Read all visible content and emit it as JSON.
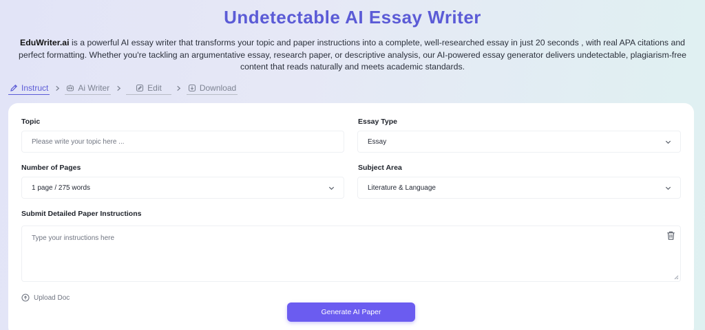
{
  "hero": {
    "title": "Undetectable AI Essay Writer",
    "brand": "EduWriter.ai",
    "description": " is a powerful AI essay writer that transforms your topic and paper instructions into a complete, well-researched essay in just 20 seconds , with real APA citations and perfect formatting. Whether you're tackling an argumentative essay, research paper, or descriptive analysis, our AI-powered essay generator delivers undetectable, plagiarism-free content that reads naturally and meets academic standards."
  },
  "steps": [
    {
      "label": "Instruct",
      "icon": "pencil-icon",
      "active": true
    },
    {
      "label": "Ai Writer",
      "icon": "robot-icon",
      "active": false
    },
    {
      "label": "Edit",
      "icon": "edit-icon",
      "active": false
    },
    {
      "label": "Download",
      "icon": "download-icon",
      "active": false
    }
  ],
  "form": {
    "topic_label": "Topic",
    "topic_placeholder": "Please write your topic here ...",
    "essay_type_label": "Essay Type",
    "essay_type_value": "Essay",
    "pages_label": "Number of Pages",
    "pages_value": "1 page / 275 words",
    "subject_label": "Subject Area",
    "subject_value": "Literature & Language",
    "instructions_label": "Submit Detailed Paper Instructions",
    "instructions_placeholder": "Type your instructions here",
    "upload_label": "Upload Doc",
    "generate_label": "Generate AI Paper"
  },
  "colors": {
    "accent": "#5b5bd6",
    "button": "#6b5cf0"
  }
}
